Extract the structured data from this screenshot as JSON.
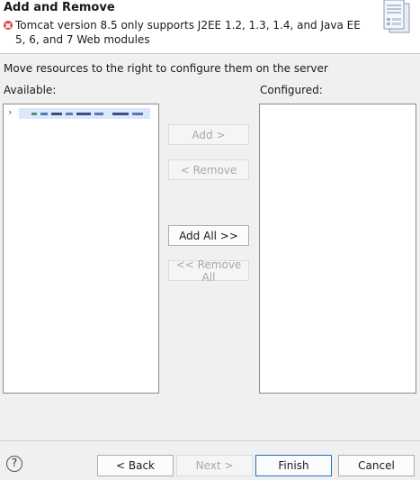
{
  "header": {
    "title": "Add and Remove",
    "error_message": "Tomcat version 8.5 only supports J2EE 1.2, 1.3, 1.4, and Java EE 5, 6, and 7 Web modules"
  },
  "instruction": "Move resources to the right to configure them on the server",
  "available": {
    "label": "Available:",
    "tree_arrow": "›"
  },
  "configured": {
    "label": "Configured:"
  },
  "buttons": {
    "add": "Add >",
    "remove": "< Remove",
    "add_all": "Add All >>",
    "remove_all": "<< Remove All"
  },
  "footer": {
    "help": "?",
    "back": "< Back",
    "next": "Next >",
    "finish": "Finish",
    "cancel": "Cancel"
  },
  "colors": {
    "error": "#d9473b",
    "selection": "#dbe8fb",
    "default_button_border": "#1a73c8"
  }
}
